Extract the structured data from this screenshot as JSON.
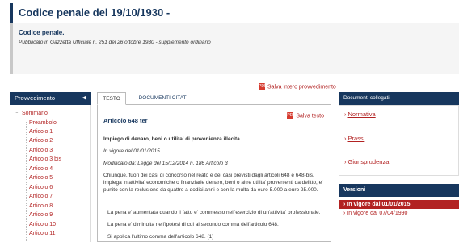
{
  "title": "Codice penale del 19/10/1930 -",
  "header": {
    "subtitle": "Codice penale.",
    "publication": "Pubblicato in Gazzetta Ufficiale n. 251 del 26 ottobre 1930 - supplemento ordinario"
  },
  "save_full_label": "Salva intero provvedimento",
  "pdf_icon_text": "PDF",
  "left_panel": {
    "heading": "Provvedimento",
    "arrow": "◀",
    "root_label": "Sommario",
    "items": [
      "Preambolo",
      "Articolo 1",
      "Articolo 2",
      "Articolo 3",
      "Articolo 3 bis",
      "Articolo 4",
      "Articolo 5",
      "Articolo 6",
      "Articolo 7",
      "Articolo 8",
      "Articolo 9",
      "Articolo 10",
      "Articolo 11"
    ]
  },
  "tabs": {
    "active": "TESTO",
    "other": "DOCUMENTI CITATI"
  },
  "article": {
    "title": "Articolo 648 ter",
    "save_label": "Salva testo",
    "rubrica": "Impiego di denaro, beni o utilita' di provenienza illecita.",
    "vigore": "In vigore dal 01/01/2015",
    "modified": "Modificato da: Legge del 15/12/2014 n. 186 Articolo 3",
    "body": "Chiunque, fuori dei casi di concorso nel reato e dei casi previsti dagli articoli 648 e 648-bis, impiega in attivita' economiche o finanziarie denaro, beni o altre utilita' provenienti da delitto, e' punito con la reclusione da quattro a dodici anni e con la multa da euro 5.000 a euro 25.000.",
    "para2": "La pena e' aumentata quando il fatto e' commesso nell'esercizio di un'attivita' professionale.",
    "para3": "La pena e' diminuita nell'ipotesi di cui al secondo comma dell'articolo 648.",
    "para4": "Si applica l'ultimo comma dell'articolo 648. (1)"
  },
  "right_panel": {
    "heading": "Documenti collegati",
    "links": [
      "Normativa",
      "Prassi",
      "Giurisprudenza"
    ],
    "versions_heading": "Versioni",
    "versions": [
      "In vigore dal 01/01/2015",
      "In vigore dal 07/04/1990"
    ]
  },
  "colors": {
    "navy": "#17375e",
    "link_red": "#b22222"
  }
}
